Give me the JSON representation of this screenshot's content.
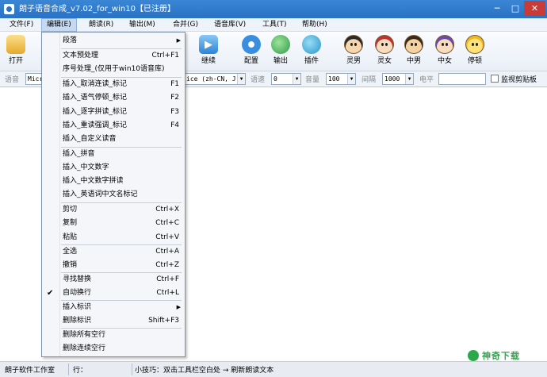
{
  "window": {
    "title": "朗子语音合成_v7.02_for_win10【已注册】",
    "controls": {
      "minimize": "─",
      "maximize": "□",
      "close": "✕"
    }
  },
  "menubar": [
    "文件(F)",
    "编辑(E)",
    "朗读(R)",
    "输出(M)",
    "合并(G)",
    "语音库(V)",
    "工具(T)",
    "帮助(H)"
  ],
  "toolbar": {
    "open": "打开",
    "continue": "继续",
    "config": "配置",
    "output": "输出",
    "plugin": "插件",
    "voices": [
      "灵男",
      "灵女",
      "中男",
      "中女"
    ],
    "stop": "停顿"
  },
  "params": {
    "voice_label": "语音",
    "voice_value_left": "Micr",
    "voice_value_right": "ice (zh-CN, J",
    "speed_label": "语速",
    "speed_value": "0",
    "volume_label": "音量",
    "volume_value": "100",
    "interval_label": "间隔",
    "interval_value": "1000",
    "page_label": "电平",
    "clipboard_label": "监视剪贴板",
    "clipboard_checked": false
  },
  "edit_menu": {
    "items": [
      {
        "label": "段落",
        "submenu": true
      },
      {
        "label": "文本预处理",
        "shortcut": "Ctrl+F1"
      },
      {
        "label": "序号处理_(仅用于win10语音库)"
      },
      {
        "label": "插入_取消连读_标记",
        "shortcut": "F1"
      },
      {
        "label": "插入_语气停顿_标记",
        "shortcut": "F2"
      },
      {
        "label": "插入_逐字拼读_标记",
        "shortcut": "F3"
      },
      {
        "label": "插入_重读强调_标记",
        "shortcut": "F4"
      },
      {
        "label": "插入_自定义读音"
      },
      {
        "label": "插入_拼音"
      },
      {
        "label": "插入_中文数字"
      },
      {
        "label": "插入_中文数字拼读"
      },
      {
        "label": "插入_英语词中文名标记"
      },
      {
        "label": "剪切",
        "shortcut": "Ctrl+X"
      },
      {
        "label": "复制",
        "shortcut": "Ctrl+C"
      },
      {
        "label": "粘贴",
        "shortcut": "Ctrl+V"
      },
      {
        "label": "全选",
        "shortcut": "Ctrl+A"
      },
      {
        "label": "撤销",
        "shortcut": "Ctrl+Z"
      },
      {
        "label": "寻找替换",
        "shortcut": "Ctrl+F"
      },
      {
        "label": "自动换行",
        "shortcut": "Ctrl+L",
        "checked": true
      },
      {
        "label": "插入标识",
        "submenu": true
      },
      {
        "label": "删除标识",
        "shortcut": "Shift+F3"
      },
      {
        "label": "删除所有空行"
      },
      {
        "label": "删除连续空行"
      }
    ],
    "check_glyph": "✔",
    "submenu_glyph": "▶"
  },
  "statusbar": {
    "company": "朗子软件工作室",
    "row": "行：",
    "tip": "小技巧：双击工具栏空白处 → 刷新朗读文本"
  },
  "watermark": {
    "text": "神奇下载"
  },
  "icons": {
    "open": "folder-icon",
    "continue": "play-icon",
    "config": "gear-icon",
    "output": "export-icon",
    "plugin": "plugin-icon",
    "stop": "pause-face-icon"
  },
  "colors": {
    "titlebar": "#2a72c4",
    "close": "#c93b36",
    "menu_active": "#c5d9f1",
    "watermark": "#2aa84a"
  }
}
